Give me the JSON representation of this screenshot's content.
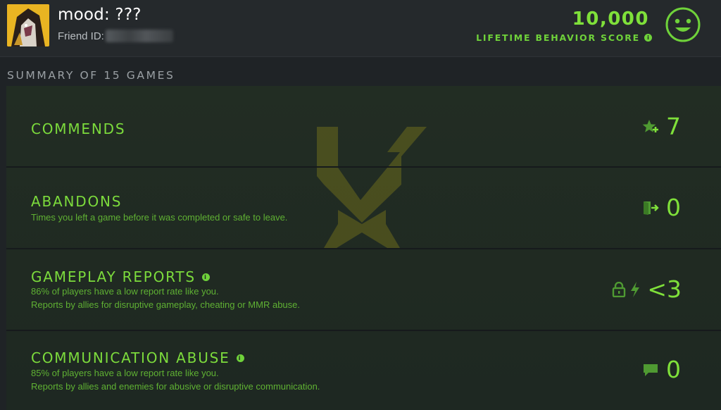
{
  "header": {
    "player_name": "mood: ???",
    "friend_id_label": "Friend ID:",
    "score_value": "10,000",
    "score_label": "LIFETIME BEHAVIOR SCORE",
    "info_glyph": "i",
    "score_icon": "smiley-face-icon",
    "accent_color": "#7fe03a"
  },
  "summary": {
    "title": "SUMMARY OF 15 GAMES",
    "rows": [
      {
        "title": "COMMENDS",
        "desc": [],
        "icon": "star-plus-icon",
        "value": "7",
        "has_info": false
      },
      {
        "title": "ABANDONS",
        "desc": [
          "Times you left a game before it was completed or safe to leave."
        ],
        "icon": "exit-door-icon",
        "value": "0",
        "has_info": false
      },
      {
        "title": "GAMEPLAY REPORTS",
        "desc": [
          "86% of players have a low report rate like you.",
          "Reports by allies for disruptive gameplay, cheating or MMR abuse."
        ],
        "icon": "lock-lightning-icon",
        "value": "<3",
        "has_info": true
      },
      {
        "title": "COMMUNICATION ABUSE",
        "desc": [
          "85% of players have a low report rate like you.",
          "Reports by allies and enemies for abusive or disruptive communication."
        ],
        "icon": "chat-bubble-icon",
        "value": "0",
        "has_info": true
      }
    ]
  }
}
